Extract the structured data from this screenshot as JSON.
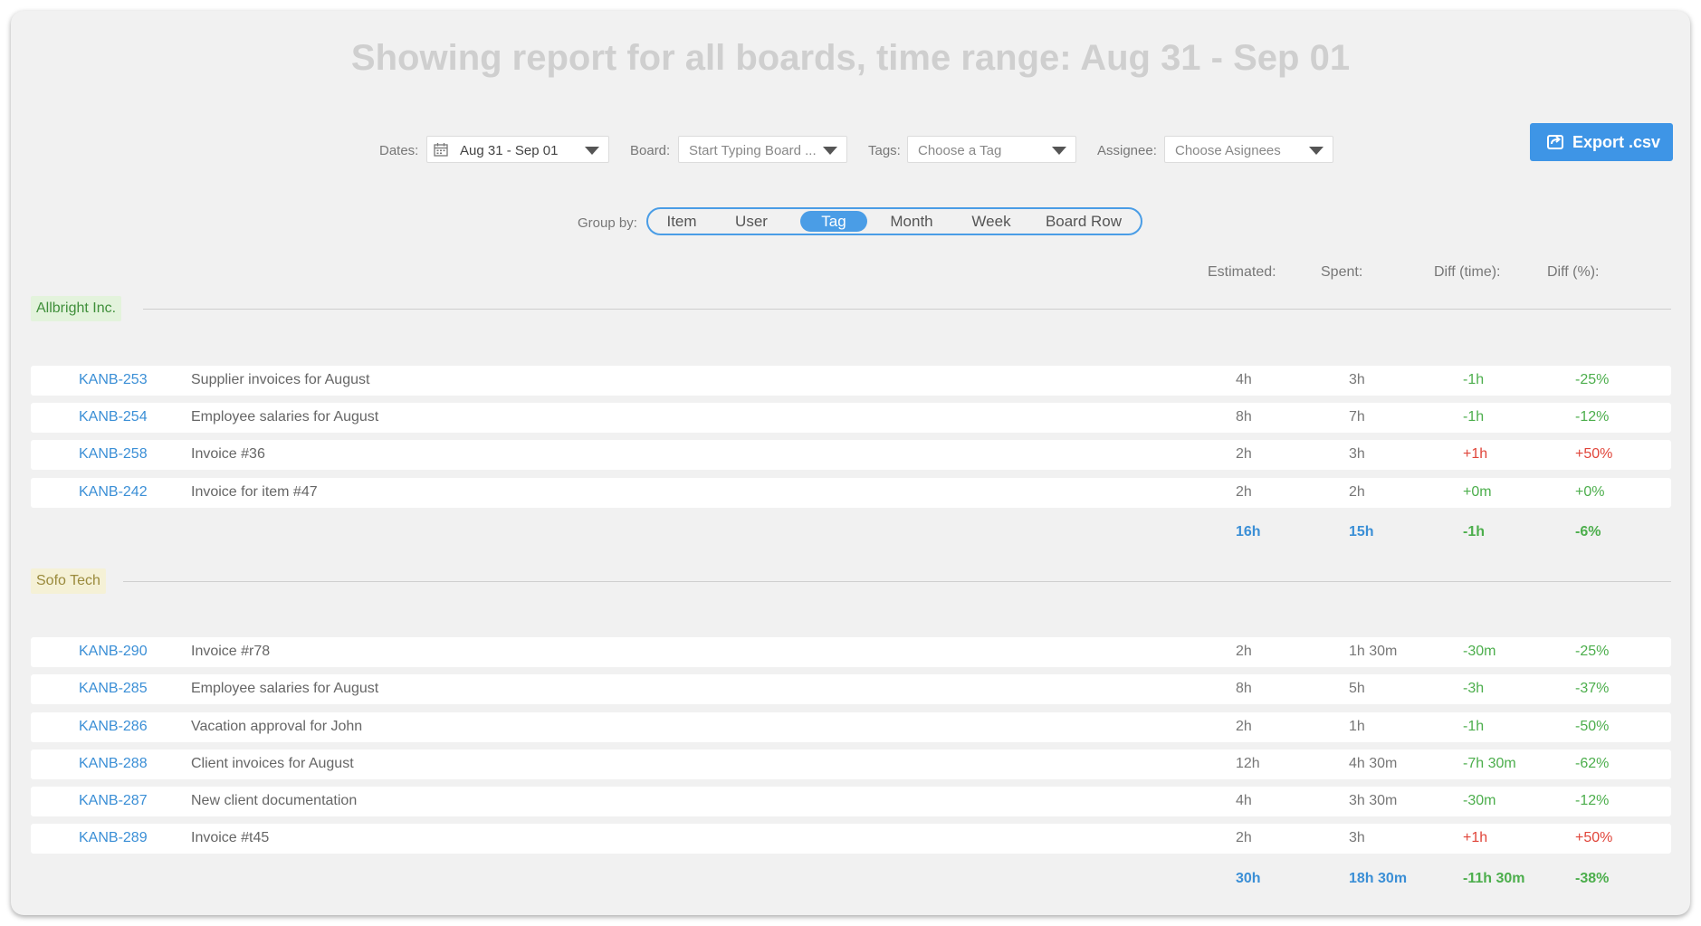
{
  "title": "Showing report for all boards, time range: Aug 31 - Sep 01",
  "filters": {
    "dates_label": "Dates:",
    "dates_value": "Aug 31 - Sep 01",
    "board_label": "Board:",
    "board_placeholder": "Start Typing Board ...",
    "tags_label": "Tags:",
    "tags_placeholder": "Choose a Tag",
    "assignee_label": "Assignee:",
    "assignee_placeholder": "Choose Asignees"
  },
  "export_label": "Export .csv",
  "group_by": {
    "label": "Group by:",
    "options": [
      "Item",
      "User",
      "Tag",
      "Month",
      "Week",
      "Board Row"
    ],
    "selected": "Tag"
  },
  "columns": {
    "estimated": "Estimated:",
    "spent": "Spent:",
    "diff_time": "Diff (time):",
    "diff_pct": "Diff (%):"
  },
  "colors": {
    "accent": "#3e95e6",
    "negative_diff": "#4cae4c",
    "positive_diff": "#e0453a",
    "group1_tag_bg": "#e3f3dc",
    "group2_tag_bg": "#f5f1d6"
  },
  "groups": [
    {
      "name": "Allbright Inc.",
      "rows": [
        {
          "id": "KANB-253",
          "name": "Supplier invoices for August",
          "est": "4h",
          "spent": "3h",
          "diff_time": "-1h",
          "diff_pct": "-25%"
        },
        {
          "id": "KANB-254",
          "name": "Employee salaries for August",
          "est": "8h",
          "spent": "7h",
          "diff_time": "-1h",
          "diff_pct": "-12%"
        },
        {
          "id": "KANB-258",
          "name": "Invoice #36",
          "est": "2h",
          "spent": "3h",
          "diff_time": "+1h",
          "diff_pct": "+50%"
        },
        {
          "id": "KANB-242",
          "name": "Invoice for item #47",
          "est": "2h",
          "spent": "2h",
          "diff_time": "+0m",
          "diff_pct": "+0%"
        }
      ],
      "totals": {
        "est": "16h",
        "spent": "15h",
        "diff_time": "-1h",
        "diff_pct": "-6%"
      }
    },
    {
      "name": "Sofo Tech",
      "rows": [
        {
          "id": "KANB-290",
          "name": "Invoice #r78",
          "est": "2h",
          "spent": "1h 30m",
          "diff_time": "-30m",
          "diff_pct": "-25%"
        },
        {
          "id": "KANB-285",
          "name": "Employee salaries for August",
          "est": "8h",
          "spent": "5h",
          "diff_time": "-3h",
          "diff_pct": "-37%"
        },
        {
          "id": "KANB-286",
          "name": "Vacation approval for John",
          "est": "2h",
          "spent": "1h",
          "diff_time": "-1h",
          "diff_pct": "-50%"
        },
        {
          "id": "KANB-288",
          "name": "Client invoices for August",
          "est": "12h",
          "spent": "4h 30m",
          "diff_time": "-7h 30m",
          "diff_pct": "-62%"
        },
        {
          "id": "KANB-287",
          "name": "New client documentation",
          "est": "4h",
          "spent": "3h 30m",
          "diff_time": "-30m",
          "diff_pct": "-12%"
        },
        {
          "id": "KANB-289",
          "name": "Invoice #t45",
          "est": "2h",
          "spent": "3h",
          "diff_time": "+1h",
          "diff_pct": "+50%"
        }
      ],
      "totals": {
        "est": "30h",
        "spent": "18h 30m",
        "diff_time": "-11h 30m",
        "diff_pct": "-38%"
      }
    }
  ]
}
